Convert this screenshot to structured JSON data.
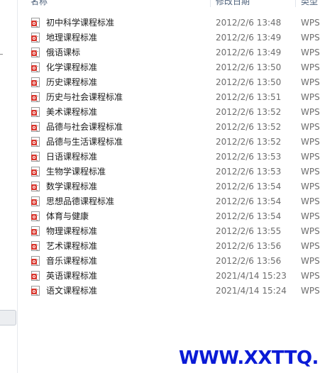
{
  "columns": {
    "name": "名称",
    "date": "修改日期",
    "type": "类型"
  },
  "files": [
    {
      "name": "初中科学课程标准",
      "date": "2012/2/6 13:48",
      "type": "WPS"
    },
    {
      "name": "地理课程标准",
      "date": "2012/2/6 13:49",
      "type": "WPS"
    },
    {
      "name": "俄语课标",
      "date": "2012/2/6 13:49",
      "type": "WPS"
    },
    {
      "name": "化学课程标准",
      "date": "2012/2/6 13:50",
      "type": "WPS"
    },
    {
      "name": "历史课程标准",
      "date": "2012/2/6 13:50",
      "type": "WPS"
    },
    {
      "name": "历史与社会课程标准",
      "date": "2012/2/6 13:51",
      "type": "WPS"
    },
    {
      "name": "美术课程标准",
      "date": "2012/2/6 13:52",
      "type": "WPS"
    },
    {
      "name": "品德与社会课程标准",
      "date": "2012/2/6 13:52",
      "type": "WPS"
    },
    {
      "name": "品德与生活课程标准",
      "date": "2012/2/6 13:52",
      "type": "WPS"
    },
    {
      "name": "日语课程标准",
      "date": "2012/2/6 13:53",
      "type": "WPS"
    },
    {
      "name": "生物学课程标准",
      "date": "2012/2/6 13:53",
      "type": "WPS"
    },
    {
      "name": "数学课程标准",
      "date": "2012/2/6 13:54",
      "type": "WPS"
    },
    {
      "name": "思想品德课程标准",
      "date": "2012/2/6 13:54",
      "type": "WPS"
    },
    {
      "name": "体育与健康",
      "date": "2012/2/6 13:54",
      "type": "WPS"
    },
    {
      "name": "物理课程标准",
      "date": "2012/2/6 13:55",
      "type": "WPS"
    },
    {
      "name": "艺术课程标准",
      "date": "2012/2/6 13:56",
      "type": "WPS"
    },
    {
      "name": "音乐课程标准",
      "date": "2012/2/6 13:56",
      "type": "WPS"
    },
    {
      "name": "英语课程标准",
      "date": "2021/4/14 15:23",
      "type": "WPS"
    },
    {
      "name": "语文课程标准",
      "date": "2021/4/14 15:24",
      "type": "WPS"
    }
  ],
  "file_icon": "wps-document-icon",
  "colors": {
    "icon_badge": "#d9352c",
    "watermark": "#0a1bd6",
    "header_text": "#4c607a"
  },
  "watermark": "WWW.XXTTQ.COM"
}
